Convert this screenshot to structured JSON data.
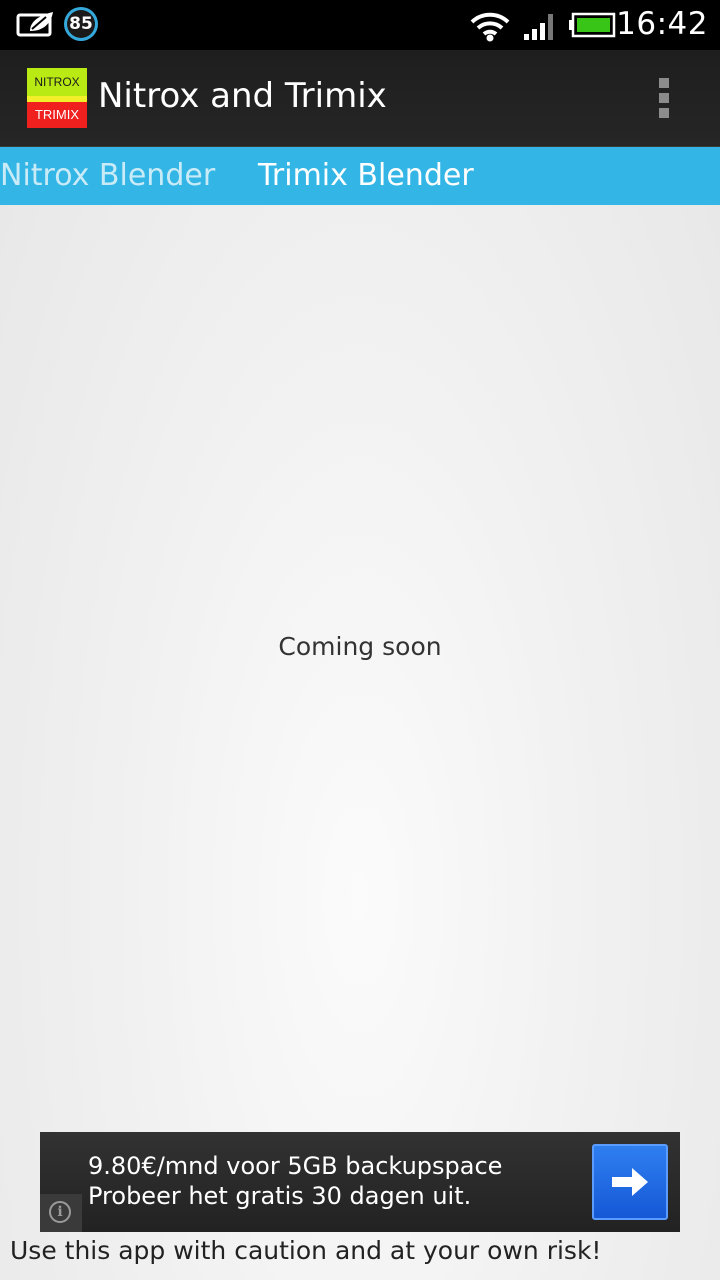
{
  "status_bar": {
    "notification_icon": "leaf-card-icon",
    "badge_count": "85",
    "wifi_icon": "wifi-icon",
    "signal_icon": "signal-icon",
    "battery_icon": "battery-icon",
    "time": "16:42"
  },
  "action_bar": {
    "logo_top": "NITROX",
    "logo_bottom": "TRIMIX",
    "title": "Nitrox and Trimix",
    "overflow_icon": "overflow-menu-icon"
  },
  "tabs": [
    {
      "label": "Nitrox Blender",
      "selected": false
    },
    {
      "label": "Trimix Blender",
      "selected": true
    }
  ],
  "content": {
    "message": "Coming soon"
  },
  "ad": {
    "line1": "9.80€/mnd voor 5GB backupspace",
    "line2": "Probeer het gratis 30 dagen uit.",
    "arrow_icon": "arrow-right-icon",
    "info_icon": "info-icon"
  },
  "footer": {
    "disclaimer": "Use this app with caution and at your own risk!"
  },
  "colors": {
    "tab_bar": "#33b5e5",
    "action_bar": "#222222",
    "ad_button": "#1e6be6"
  }
}
